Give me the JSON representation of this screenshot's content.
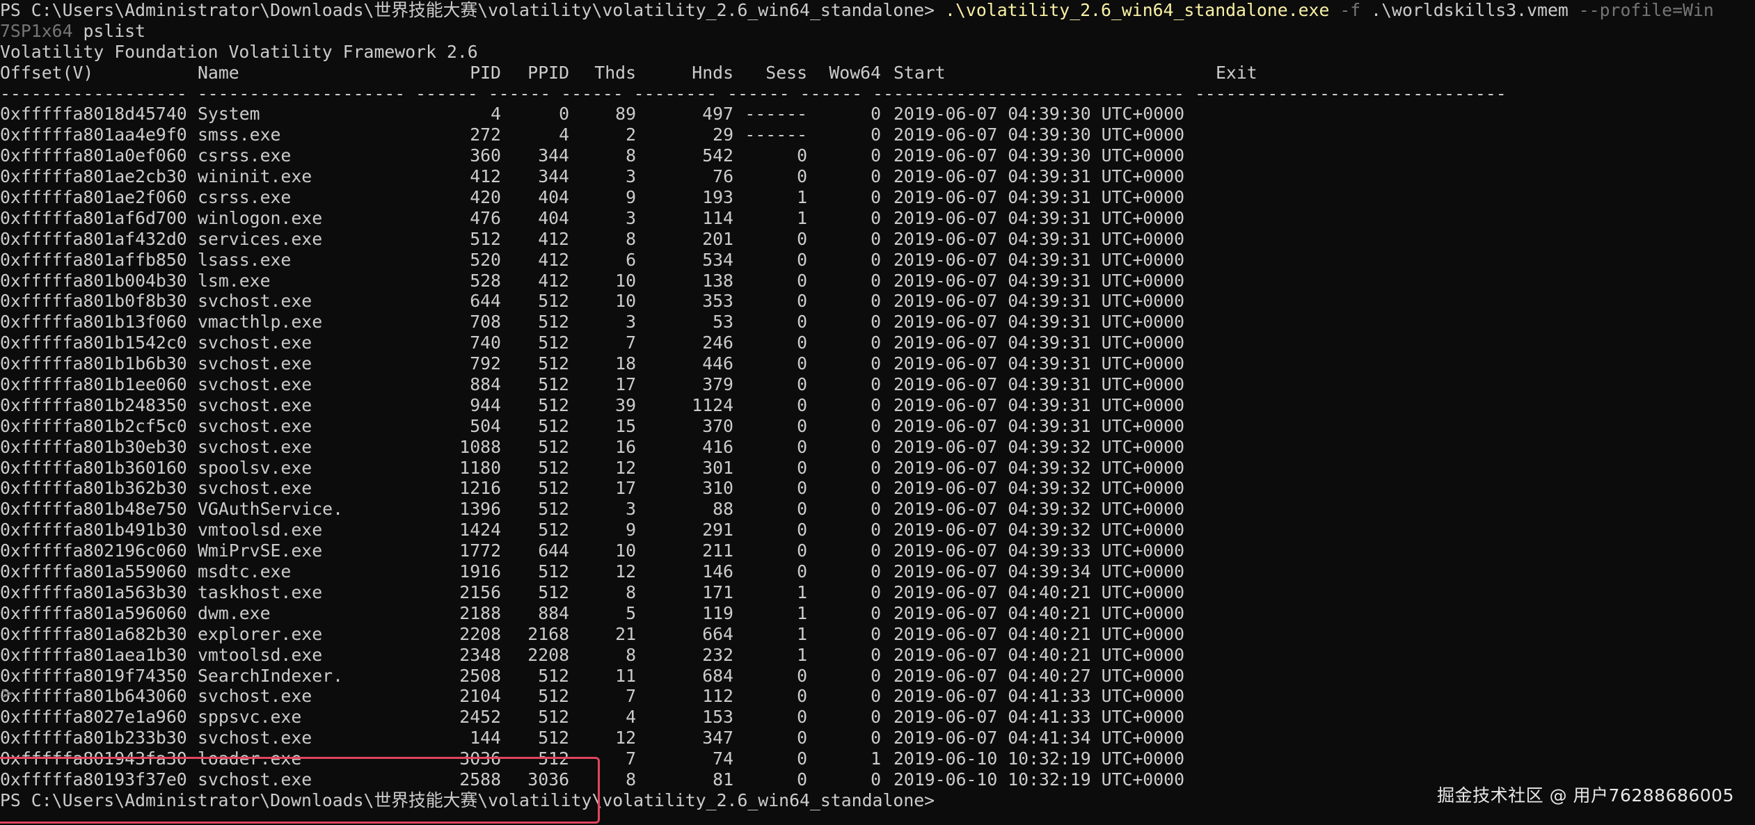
{
  "prompt_path": "PS C:\\Users\\Administrator\\Downloads\\世界技能大赛\\volatility\\volatility_2.6_win64_standalone>",
  "command_exe": ".\\volatility_2.6_win64_standalone.exe",
  "command_flag": "-f",
  "command_file": ".\\worldskills3.vmem",
  "command_profile_line1": "--profile=Win",
  "command_profile_line2": "7SP1x64",
  "command_plugin": "pslist",
  "banner": "Volatility Foundation Volatility Framework 2.6",
  "headers": {
    "offset": "Offset(V)",
    "name": "Name",
    "pid": "PID",
    "ppid": "PPID",
    "thds": "Thds",
    "hnds": "Hnds",
    "sess": "Sess",
    "wow64": "Wow64",
    "start": "Start",
    "exit": "Exit"
  },
  "separator": "------------------ -------------------- ------ ------ ------ -------- ------ ------ ------------------------------ ------------------------------",
  "processes": [
    {
      "offset": "0xfffffa8018d45740",
      "name": "System",
      "pid": "4",
      "ppid": "0",
      "thds": "89",
      "hnds": "497",
      "sess": "------",
      "wow64": "0",
      "start": "2019-06-07 04:39:30 UTC+0000"
    },
    {
      "offset": "0xfffffa801aa4e9f0",
      "name": "smss.exe",
      "pid": "272",
      "ppid": "4",
      "thds": "2",
      "hnds": "29",
      "sess": "------",
      "wow64": "0",
      "start": "2019-06-07 04:39:30 UTC+0000"
    },
    {
      "offset": "0xfffffa801a0ef060",
      "name": "csrss.exe",
      "pid": "360",
      "ppid": "344",
      "thds": "8",
      "hnds": "542",
      "sess": "0",
      "wow64": "0",
      "start": "2019-06-07 04:39:30 UTC+0000"
    },
    {
      "offset": "0xfffffa801ae2cb30",
      "name": "wininit.exe",
      "pid": "412",
      "ppid": "344",
      "thds": "3",
      "hnds": "76",
      "sess": "0",
      "wow64": "0",
      "start": "2019-06-07 04:39:31 UTC+0000"
    },
    {
      "offset": "0xfffffa801ae2f060",
      "name": "csrss.exe",
      "pid": "420",
      "ppid": "404",
      "thds": "9",
      "hnds": "193",
      "sess": "1",
      "wow64": "0",
      "start": "2019-06-07 04:39:31 UTC+0000"
    },
    {
      "offset": "0xfffffa801af6d700",
      "name": "winlogon.exe",
      "pid": "476",
      "ppid": "404",
      "thds": "3",
      "hnds": "114",
      "sess": "1",
      "wow64": "0",
      "start": "2019-06-07 04:39:31 UTC+0000"
    },
    {
      "offset": "0xfffffa801af432d0",
      "name": "services.exe",
      "pid": "512",
      "ppid": "412",
      "thds": "8",
      "hnds": "201",
      "sess": "0",
      "wow64": "0",
      "start": "2019-06-07 04:39:31 UTC+0000"
    },
    {
      "offset": "0xfffffa801affb850",
      "name": "lsass.exe",
      "pid": "520",
      "ppid": "412",
      "thds": "6",
      "hnds": "534",
      "sess": "0",
      "wow64": "0",
      "start": "2019-06-07 04:39:31 UTC+0000"
    },
    {
      "offset": "0xfffffa801b004b30",
      "name": "lsm.exe",
      "pid": "528",
      "ppid": "412",
      "thds": "10",
      "hnds": "138",
      "sess": "0",
      "wow64": "0",
      "start": "2019-06-07 04:39:31 UTC+0000"
    },
    {
      "offset": "0xfffffa801b0f8b30",
      "name": "svchost.exe",
      "pid": "644",
      "ppid": "512",
      "thds": "10",
      "hnds": "353",
      "sess": "0",
      "wow64": "0",
      "start": "2019-06-07 04:39:31 UTC+0000"
    },
    {
      "offset": "0xfffffa801b13f060",
      "name": "vmacthlp.exe",
      "pid": "708",
      "ppid": "512",
      "thds": "3",
      "hnds": "53",
      "sess": "0",
      "wow64": "0",
      "start": "2019-06-07 04:39:31 UTC+0000"
    },
    {
      "offset": "0xfffffa801b1542c0",
      "name": "svchost.exe",
      "pid": "740",
      "ppid": "512",
      "thds": "7",
      "hnds": "246",
      "sess": "0",
      "wow64": "0",
      "start": "2019-06-07 04:39:31 UTC+0000"
    },
    {
      "offset": "0xfffffa801b1b6b30",
      "name": "svchost.exe",
      "pid": "792",
      "ppid": "512",
      "thds": "18",
      "hnds": "446",
      "sess": "0",
      "wow64": "0",
      "start": "2019-06-07 04:39:31 UTC+0000"
    },
    {
      "offset": "0xfffffa801b1ee060",
      "name": "svchost.exe",
      "pid": "884",
      "ppid": "512",
      "thds": "17",
      "hnds": "379",
      "sess": "0",
      "wow64": "0",
      "start": "2019-06-07 04:39:31 UTC+0000"
    },
    {
      "offset": "0xfffffa801b248350",
      "name": "svchost.exe",
      "pid": "944",
      "ppid": "512",
      "thds": "39",
      "hnds": "1124",
      "sess": "0",
      "wow64": "0",
      "start": "2019-06-07 04:39:31 UTC+0000"
    },
    {
      "offset": "0xfffffa801b2cf5c0",
      "name": "svchost.exe",
      "pid": "504",
      "ppid": "512",
      "thds": "15",
      "hnds": "370",
      "sess": "0",
      "wow64": "0",
      "start": "2019-06-07 04:39:31 UTC+0000"
    },
    {
      "offset": "0xfffffa801b30eb30",
      "name": "svchost.exe",
      "pid": "1088",
      "ppid": "512",
      "thds": "16",
      "hnds": "416",
      "sess": "0",
      "wow64": "0",
      "start": "2019-06-07 04:39:32 UTC+0000"
    },
    {
      "offset": "0xfffffa801b360160",
      "name": "spoolsv.exe",
      "pid": "1180",
      "ppid": "512",
      "thds": "12",
      "hnds": "301",
      "sess": "0",
      "wow64": "0",
      "start": "2019-06-07 04:39:32 UTC+0000"
    },
    {
      "offset": "0xfffffa801b362b30",
      "name": "svchost.exe",
      "pid": "1216",
      "ppid": "512",
      "thds": "17",
      "hnds": "310",
      "sess": "0",
      "wow64": "0",
      "start": "2019-06-07 04:39:32 UTC+0000"
    },
    {
      "offset": "0xfffffa801b48e750",
      "name": "VGAuthService.",
      "pid": "1396",
      "ppid": "512",
      "thds": "3",
      "hnds": "88",
      "sess": "0",
      "wow64": "0",
      "start": "2019-06-07 04:39:32 UTC+0000"
    },
    {
      "offset": "0xfffffa801b491b30",
      "name": "vmtoolsd.exe",
      "pid": "1424",
      "ppid": "512",
      "thds": "9",
      "hnds": "291",
      "sess": "0",
      "wow64": "0",
      "start": "2019-06-07 04:39:32 UTC+0000"
    },
    {
      "offset": "0xfffffa802196c060",
      "name": "WmiPrvSE.exe",
      "pid": "1772",
      "ppid": "644",
      "thds": "10",
      "hnds": "211",
      "sess": "0",
      "wow64": "0",
      "start": "2019-06-07 04:39:33 UTC+0000"
    },
    {
      "offset": "0xfffffa801a559060",
      "name": "msdtc.exe",
      "pid": "1916",
      "ppid": "512",
      "thds": "12",
      "hnds": "146",
      "sess": "0",
      "wow64": "0",
      "start": "2019-06-07 04:39:34 UTC+0000"
    },
    {
      "offset": "0xfffffa801a563b30",
      "name": "taskhost.exe",
      "pid": "2156",
      "ppid": "512",
      "thds": "8",
      "hnds": "171",
      "sess": "1",
      "wow64": "0",
      "start": "2019-06-07 04:40:21 UTC+0000"
    },
    {
      "offset": "0xfffffa801a596060",
      "name": "dwm.exe",
      "pid": "2188",
      "ppid": "884",
      "thds": "5",
      "hnds": "119",
      "sess": "1",
      "wow64": "0",
      "start": "2019-06-07 04:40:21 UTC+0000"
    },
    {
      "offset": "0xfffffa801a682b30",
      "name": "explorer.exe",
      "pid": "2208",
      "ppid": "2168",
      "thds": "21",
      "hnds": "664",
      "sess": "1",
      "wow64": "0",
      "start": "2019-06-07 04:40:21 UTC+0000"
    },
    {
      "offset": "0xfffffa801aea1b30",
      "name": "vmtoolsd.exe",
      "pid": "2348",
      "ppid": "2208",
      "thds": "8",
      "hnds": "232",
      "sess": "1",
      "wow64": "0",
      "start": "2019-06-07 04:40:21 UTC+0000"
    },
    {
      "offset": "0xfffffa8019f74350",
      "name": "SearchIndexer.",
      "pid": "2508",
      "ppid": "512",
      "thds": "11",
      "hnds": "684",
      "sess": "0",
      "wow64": "0",
      "start": "2019-06-07 04:40:27 UTC+0000"
    },
    {
      "offset": "0xfffffa801b643060",
      "name": "svchost.exe",
      "pid": "2104",
      "ppid": "512",
      "thds": "7",
      "hnds": "112",
      "sess": "0",
      "wow64": "0",
      "start": "2019-06-07 04:41:33 UTC+0000"
    },
    {
      "offset": "0xfffffa8027e1a960",
      "name": "sppsvc.exe",
      "pid": "2452",
      "ppid": "512",
      "thds": "4",
      "hnds": "153",
      "sess": "0",
      "wow64": "0",
      "start": "2019-06-07 04:41:33 UTC+0000"
    },
    {
      "offset": "0xfffffa801b233b30",
      "name": "svchost.exe",
      "pid": "144",
      "ppid": "512",
      "thds": "12",
      "hnds": "347",
      "sess": "0",
      "wow64": "0",
      "start": "2019-06-07 04:41:34 UTC+0000"
    },
    {
      "offset": "0xfffffa801943fa30",
      "name": "loader.exe",
      "pid": "3036",
      "ppid": "512",
      "thds": "7",
      "hnds": "74",
      "sess": "0",
      "wow64": "1",
      "start": "2019-06-10 10:32:19 UTC+0000"
    },
    {
      "offset": "0xfffffa80193f37e0",
      "name": "svchost.exe",
      "pid": "2588",
      "ppid": "3036",
      "thds": "8",
      "hnds": "81",
      "sess": "0",
      "wow64": "0",
      "start": "2019-06-10 10:32:19 UTC+0000"
    }
  ],
  "final_prompt": "PS C:\\Users\\Administrator\\Downloads\\世界技能大赛\\volatility\\volatility_2.6_win64_standalone>",
  "watermark": "掘金技术社区 @ 用户76288686005",
  "caret_glyph": ">",
  "colors": {
    "background": "#0c0c0c",
    "text": "#cccccc",
    "command": "#f9f1a5",
    "parameter": "#767676",
    "highlight_box": "#e0465e"
  }
}
